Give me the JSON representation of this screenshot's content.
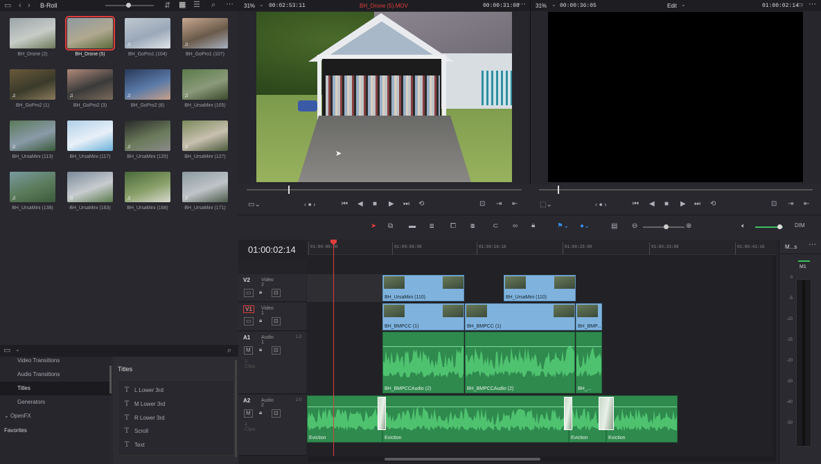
{
  "media_pool": {
    "bin": "B-Roll",
    "clips": [
      {
        "label": "BH_Drone (2)",
        "audio": false
      },
      {
        "label": "BH_Drone (5)",
        "audio": false,
        "selected": true
      },
      {
        "label": "BH_GoPro1 (104)",
        "audio": true
      },
      {
        "label": "BH_GoPro1 (107)",
        "audio": true
      },
      {
        "label": "BH_GoPro2 (1)",
        "audio": true
      },
      {
        "label": "BH_GoPro2 (3)",
        "audio": true
      },
      {
        "label": "BH_GoPro2 (8)",
        "audio": true
      },
      {
        "label": "BH_UrsaMini (105)",
        "audio": true
      },
      {
        "label": "BH_UrsaMini (113)",
        "audio": true
      },
      {
        "label": "BH_UrsaMini (117)",
        "audio": true
      },
      {
        "label": "BH_UrsaMini (120)",
        "audio": true
      },
      {
        "label": "BH_UrsaMini (127)",
        "audio": true
      },
      {
        "label": "BH_UrsaMini (138)",
        "audio": true
      },
      {
        "label": "BH_UrsaMini (163)",
        "audio": true
      },
      {
        "label": "BH_UrsaMini (168)",
        "audio": true
      },
      {
        "label": "BH_UrsaMini (171)",
        "audio": true
      }
    ]
  },
  "source_viewer": {
    "zoom": "31%",
    "duration": "00:02:53:11",
    "clip_name": "BH_Drone (5).MOV",
    "timecode": "00:00:31:08"
  },
  "timeline_viewer": {
    "zoom": "31%",
    "duration": "00:00:36:05",
    "mode": "Edit",
    "timecode": "01:00:02:14"
  },
  "effects": {
    "categories": [
      "Video Transitions",
      "Audio Transitions",
      "Titles",
      "Generators"
    ],
    "openfx": "OpenFX",
    "favorites": "Favorites",
    "panel_title": "Titles",
    "titles": [
      "L Lower 3rd",
      "M Lower 3rd",
      "R Lower 3rd",
      "Scroll",
      "Text"
    ]
  },
  "timeline": {
    "timecode": "01:00:02:14",
    "ruler": [
      "01:00:00:00",
      "01:00:08:08",
      "01:00:16:16",
      "01:00:25:00",
      "01:00:33:08",
      "01:00:41:16"
    ],
    "tracks": [
      {
        "id": "V2",
        "name": "Video 2",
        "clips": [
          "BH_UrsaMini (110)",
          "BH_UrsaMini (110)"
        ]
      },
      {
        "id": "V1",
        "name": "Video 1",
        "clips": [
          "BH_BMPCC (1)",
          "BH_BMPCC (1)",
          "BH_BMP..."
        ]
      },
      {
        "id": "A1",
        "name": "Audio 1",
        "channels": "1.0",
        "count": "3 Clips",
        "clips": [
          "BH_BMPCCAudio (2)",
          "BH_BMPCCAudio (2)",
          "BH_..."
        ]
      },
      {
        "id": "A2",
        "name": "Audio 2",
        "channels": "2.0",
        "count": "4 Clips",
        "clips": [
          "Eviction",
          "Eviction",
          "Eviction",
          "Eviction"
        ]
      }
    ]
  },
  "mixer": {
    "title": "M...s",
    "channel": "M1",
    "scale": [
      "0",
      "-5",
      "-10",
      "-15",
      "-20",
      "-30",
      "-40",
      "-50"
    ]
  },
  "colors": {
    "accent": "#e03c3c",
    "video_clip": "#7fb3de",
    "audio_clip": "#2f8a4e",
    "playhead": "#e03c3c"
  }
}
